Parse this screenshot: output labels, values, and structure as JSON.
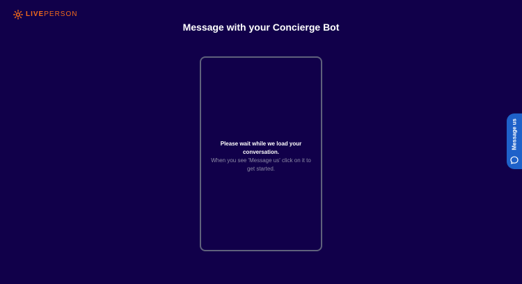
{
  "brand": {
    "live": "LIVE",
    "person": "PERSON",
    "color": "#f26a1b"
  },
  "page": {
    "title": "Message with your Concierge Bot",
    "background": "#11004a"
  },
  "chat": {
    "loading_primary": "Please wait while we load your conversation.",
    "loading_secondary": "When you see 'Message us' click on it to get started."
  },
  "message_tab": {
    "label": "Message us",
    "icon": "chat-bubble-icon",
    "color": "#1e61c9"
  }
}
